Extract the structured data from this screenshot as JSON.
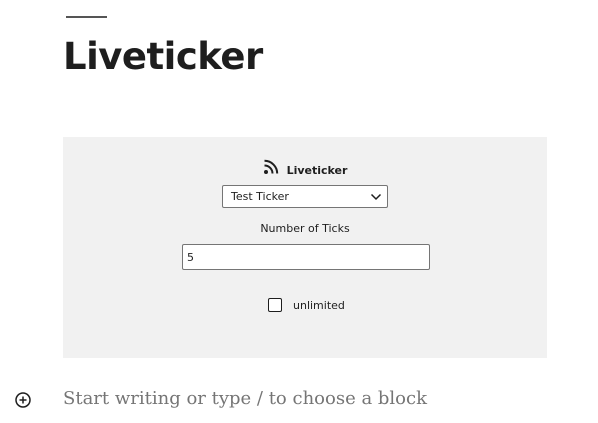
{
  "page": {
    "title": "Liveticker"
  },
  "block": {
    "icon": "rss-icon",
    "name": "Liveticker",
    "ticker_select": {
      "selected": "Test Ticker"
    },
    "ticks": {
      "label": "Number of Ticks",
      "value": "5"
    },
    "unlimited": {
      "label": "unlimited",
      "checked": false
    }
  },
  "editor": {
    "add_block_icon": "circle-plus-icon",
    "placeholder": "Start writing or type / to choose a block"
  }
}
